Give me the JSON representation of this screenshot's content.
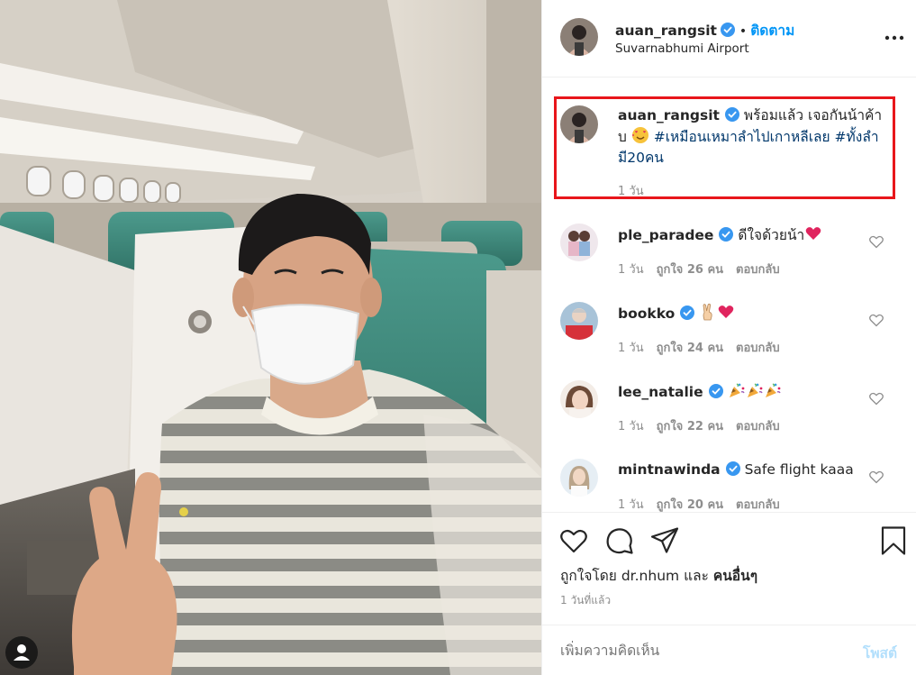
{
  "post": {
    "username": "auan_rangsit",
    "follow_label": "ติดตาม",
    "location": "Suvarnabhumi Airport",
    "more_icon": "more-horizontal-icon"
  },
  "caption": {
    "username": "auan_rangsit",
    "text_start": "พร้อมแล้ว เจอกันน้าค้าบ",
    "emoji": "smiling-face-with-hearts",
    "hashtags": [
      "#เหมือนเหมาลำไปเกาหลีเลย",
      "#ทั้งลำมี20คน"
    ],
    "time": "1 วัน"
  },
  "comments": [
    {
      "username": "ple_paradee",
      "text": "ดีใจด้วยน้า",
      "emojis": [
        "heart"
      ],
      "time": "1 วัน",
      "likes": "ถูกใจ 26 คน",
      "reply": "ตอบกลับ"
    },
    {
      "username": "bookko",
      "text": "",
      "emojis": [
        "victory-hand",
        "heart"
      ],
      "time": "1 วัน",
      "likes": "ถูกใจ 24 คน",
      "reply": "ตอบกลับ"
    },
    {
      "username": "lee_natalie",
      "text": "",
      "emojis": [
        "party-popper",
        "party-popper",
        "party-popper"
      ],
      "time": "1 วัน",
      "likes": "ถูกใจ 22 คน",
      "reply": "ตอบกลับ"
    },
    {
      "username": "mintnawinda",
      "text": "Safe flight kaaa",
      "emojis": [],
      "time": "1 วัน",
      "likes": "ถูกใจ 20 คน",
      "reply": "ตอบกลับ"
    }
  ],
  "actions": {
    "likes_prefix": "ถูกใจโดย",
    "liked_by_user": "dr.nhum",
    "likes_and": "และ",
    "likes_others": "คนอื่นๆ",
    "timestamp": "1 วันที่แล้ว"
  },
  "comment_box": {
    "placeholder": "เพิ่มความคิดเห็น",
    "post_label": "โพสต์"
  },
  "colors": {
    "accent": "#0095f6",
    "highlight_border": "#e8161b",
    "heart": "#e0245e",
    "post_disabled": "#b2dffc"
  }
}
